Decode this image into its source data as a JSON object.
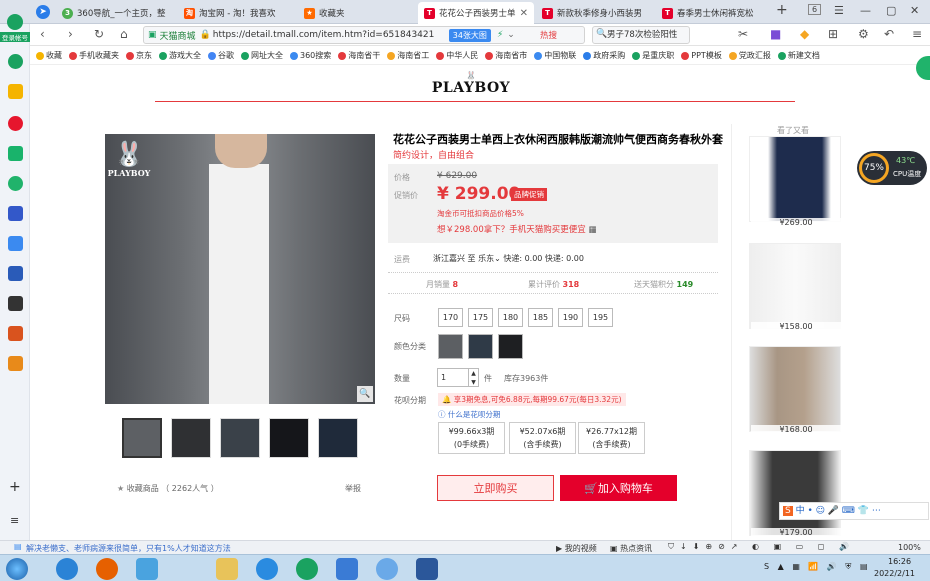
{
  "tabs": [
    {
      "label": "360导航_一个主页，整",
      "color": "#4caf50"
    },
    {
      "label": "淘宝网 - 淘！我喜欢",
      "color": "#ff5000"
    },
    {
      "label": "收藏夹",
      "color": "#ff6a00"
    },
    {
      "label": "花花公子西装男士单西",
      "color": "#e4002b",
      "active": true
    },
    {
      "label": "新款秋季修身小西装男",
      "color": "#e4002b"
    },
    {
      "label": "春季男士休闲裤宽松",
      "color": "#e4002b"
    }
  ],
  "tab_controls": {
    "new_tab": "+",
    "tab_count": "6"
  },
  "address": {
    "site_label": "天猫商城",
    "url": "https://detail.tmall.com/item.htm?id=651843421",
    "badge": "34张大图",
    "hot": "热搜"
  },
  "search": {
    "text": "男子78次检验阳性"
  },
  "bookmarks": [
    "收藏",
    "手机收藏夹",
    "京东",
    "游戏大全",
    "谷歌",
    "网址大全",
    "360搜索",
    "海南省干",
    "海南省工",
    "中华人民",
    "海南省市",
    "中国物联",
    "政府采购",
    "是重庆职",
    "PPT模板",
    "党政汇报",
    "新建文档"
  ],
  "sidebar": {
    "login_label": "登录帐号"
  },
  "brand": {
    "logo_text": "PLAYBOY"
  },
  "product": {
    "title": "花花公子西装男士单西上衣休闲西服韩版潮流帅气便西商务春秋外套",
    "subtitle": "简约设计，自由组合",
    "price_label": "价格",
    "original_price": "¥ 629.00",
    "promo_label": "促销价",
    "promo_price": "¥ 299.00",
    "promo_badge": "品牌促销",
    "coin_note": "淘金币可抵扣商品价格5%",
    "cheaper_note": "想￥298.00拿下？手机天猫购买更便宜",
    "ship_label": "运费",
    "ship_from": "浙江嘉兴",
    "ship_to": "至 乐东",
    "ship_info": "快递: 0.00 快递: 0.00",
    "monthly_label": "月销量",
    "monthly_value": "8",
    "review_label": "累计评价",
    "review_value": "318",
    "points_label": "送天猫积分",
    "points_value": "149",
    "size_label": "尺码",
    "sizes": [
      "170",
      "175",
      "180",
      "185",
      "190",
      "195"
    ],
    "color_label": "颜色分类",
    "qty_label": "数量",
    "qty_value": "1",
    "qty_unit": "件",
    "stock": "库存3963件",
    "installment_label": "花呗分期",
    "installment_note": "享3期免息,可免6.88元,每期99.67元(每日3.32元)",
    "installment_help": "什么是花呗分期",
    "plans": [
      {
        "amount": "¥99.66x3期",
        "fee": "(0手续费)"
      },
      {
        "amount": "¥52.07x6期",
        "fee": "(含手续费)"
      },
      {
        "amount": "¥26.77x12期",
        "fee": "(含手续费)"
      }
    ],
    "buy_now": "立即购买",
    "add_cart": "加入购物车",
    "favorite": "收藏商品",
    "favorite_count": "（ 2262人气 ）",
    "report": "举报"
  },
  "recommend": {
    "title": "看了又看",
    "prices": [
      "¥269.00",
      "¥158.00",
      "¥168.00",
      "¥179.00"
    ]
  },
  "cpu": {
    "percent": "75%",
    "temp": "43℃",
    "label": "CPU温度"
  },
  "status_bar": {
    "news": "解决老懒支、老师病源来很简单，只有1%人才知道这方法",
    "video": "我的视频",
    "hot_news": "热点资讯",
    "zoom": "100%"
  },
  "clock": {
    "time": "16:26",
    "date": "2022/2/11"
  },
  "colors": {
    "accent": "#e4393c",
    "tmall": "#e4002b"
  }
}
